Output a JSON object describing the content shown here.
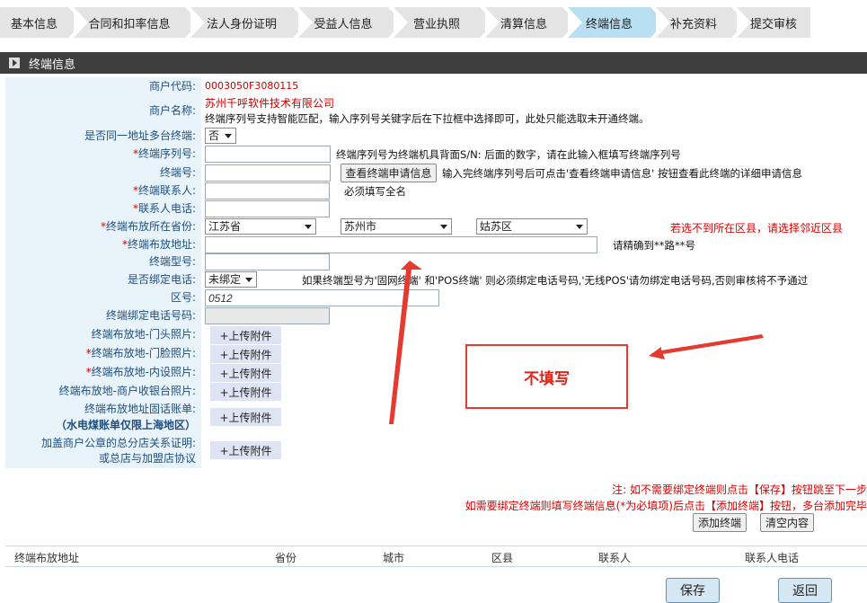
{
  "steps": [
    "基本信息",
    "合同和扣率信息",
    "法人身份证明",
    "受益人信息",
    "营业执照",
    "清算信息",
    "终端信息",
    "补充资料",
    "提交审核"
  ],
  "section_title": "终端信息",
  "form": {
    "merchant_code_label": "商户代码:",
    "merchant_code": "0003050F3080115",
    "merchant_name_label": "商户名称:",
    "merchant_name": "苏州千呼软件技术有限公司",
    "serial_tip": "终端序列号支持智能匹配，输入序列号关键字后在下拉框中选择即可，此处只能选取未开通终端。",
    "same_addr_label": "是否同一地址多台终端:",
    "same_addr_value": "否",
    "serial_label": "终端序列号:",
    "serial_hint": "终端序列号为终端机具背面S/N: 后面的数字，请在此输入框填写终端序列号",
    "terminal_no_label": "终端号:",
    "view_apply_btn": "查看终端申请信息",
    "terminal_no_hint": "输入完终端序列号后可点击'查看终端申请信息' 按钮查看此终端的详细申请信息",
    "contact_label": "终端联系人:",
    "contact_hint": "必须填写全名",
    "contact_phone_label": "联系人电话:",
    "province_label": "终端布放所在省份:",
    "province": "江苏省",
    "city": "苏州市",
    "district": "姑苏区",
    "district_hint": "若选不到所在区县，请选择邻近区县",
    "address_label": "终端布放地址:",
    "address_hint": "请精确到**路**号",
    "model_label": "终端型号:",
    "bind_phone_label": "是否绑定电话:",
    "bind_phone_value": "未绑定",
    "bind_phone_hint": "如果终端型号为'固网终端' 和'POS终端' 则必须绑定电话号码,'无线POS'请勿绑定电话号码,否则审核将不予通过",
    "area_code_label": "区号:",
    "area_code_value": "0512",
    "bound_phone_label": "终端绑定电话号码:",
    "photo_door_label": "终端布放地-门头照片:",
    "photo_face_label": "终端布放地-门脸照片:",
    "photo_inside_label": "终端布放地-内设照片:",
    "photo_cashier_label": "终端布放地-商户收银台照片:",
    "bill_label_1": "终端布放地址固话账单:",
    "bill_label_2": "（水电煤账单仅限上海地区）",
    "stamp_label_1": "加盖商户公章的总分店关系证明:",
    "stamp_label_2": "或总店与加盟店协议",
    "upload_label": "+上传附件"
  },
  "notes": {
    "line1": "注: 如不需要绑定终端则点击【保存】按钮跳至下一步",
    "line2": "如需要绑定终端则填写终端信息(*为必填项)后点击【添加终端】按钮，多台添加完毕"
  },
  "add_terminal_btn": "添加终端",
  "clear_btn": "清空内容",
  "table_headers": [
    "终端布放地址",
    "省份",
    "城市",
    "区县",
    "联系人",
    "联系人电话"
  ],
  "save_btn": "保存",
  "back_btn": "返回",
  "annotation_text": "不填写",
  "colors": {
    "active_step": "#b9dff2",
    "annotation": "#e53a2f",
    "label": "#1f4f80"
  }
}
